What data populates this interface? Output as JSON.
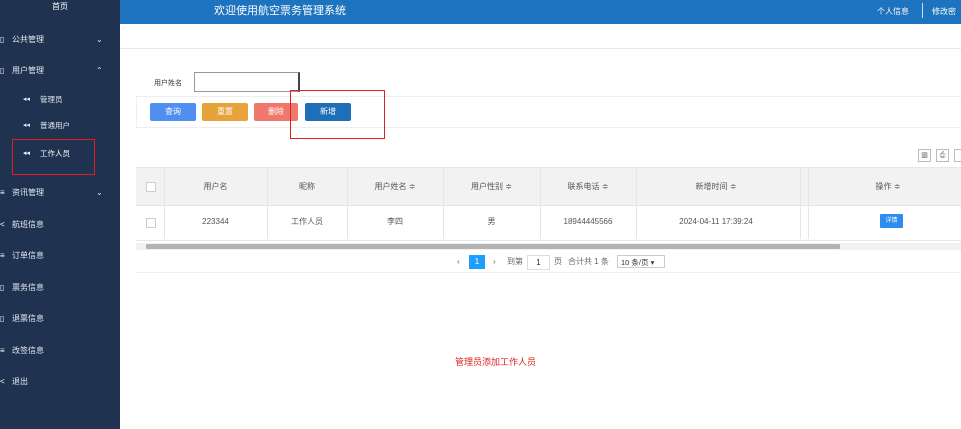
{
  "sidebar": {
    "home": "首页",
    "menus": [
      {
        "label": "公共管理",
        "icon": "folder-icon"
      },
      {
        "label": "用户管理",
        "icon": "user-icon"
      },
      {
        "label": "资讯管理",
        "icon": "news-icon"
      },
      {
        "label": "航班信息",
        "icon": "plane-icon"
      },
      {
        "label": "订单信息",
        "icon": "order-icon"
      },
      {
        "label": "票务信息",
        "icon": "ticket-icon"
      },
      {
        "label": "退票信息",
        "icon": "refund-icon"
      },
      {
        "label": "改签信息",
        "icon": "change-icon"
      },
      {
        "label": "退出",
        "icon": "logout-icon"
      }
    ],
    "user_submenu": [
      "管理员",
      "普通用户",
      "工作人员"
    ]
  },
  "header": {
    "title": "欢迎使用航空票务管理系统",
    "personal_info": "个人信息",
    "change_password": "修改密"
  },
  "search": {
    "label": "用户姓名",
    "value": "",
    "placeholder": ""
  },
  "buttons": {
    "query": "查询",
    "reset": "重置",
    "delete": "删除",
    "add": "新增"
  },
  "colors": {
    "sidebar_bg": "#1f3350",
    "topbar_bg": "#1e73be",
    "query_btn": "#4f8ff0",
    "reset_btn": "#e8a23a",
    "delete_btn": "#f0776c",
    "add_btn": "#1d6fb8",
    "annotation": "#e02020"
  },
  "table": {
    "headers": [
      "用户名",
      "昵称",
      "用户姓名 ≑",
      "用户性别 ≑",
      "联系电话 ≑",
      "新增时间 ≑",
      "操作 ≑"
    ],
    "rows": [
      {
        "username": "223344",
        "nickname": "工作人员",
        "name": "李四",
        "gender": "男",
        "phone": "18944445566",
        "created": "2024-04-11 17:39:24",
        "action": "详情"
      }
    ]
  },
  "pagination": {
    "prev": "‹",
    "current": "1",
    "next": "›",
    "goto_label": "到第",
    "goto_value": "1",
    "page_unit": "页",
    "total": "合计共 1 条",
    "page_size": "10 条/页 ▾"
  },
  "toolbar_icons": [
    "columns-icon",
    "print-icon"
  ],
  "annotation": "管理员添加工作人员"
}
